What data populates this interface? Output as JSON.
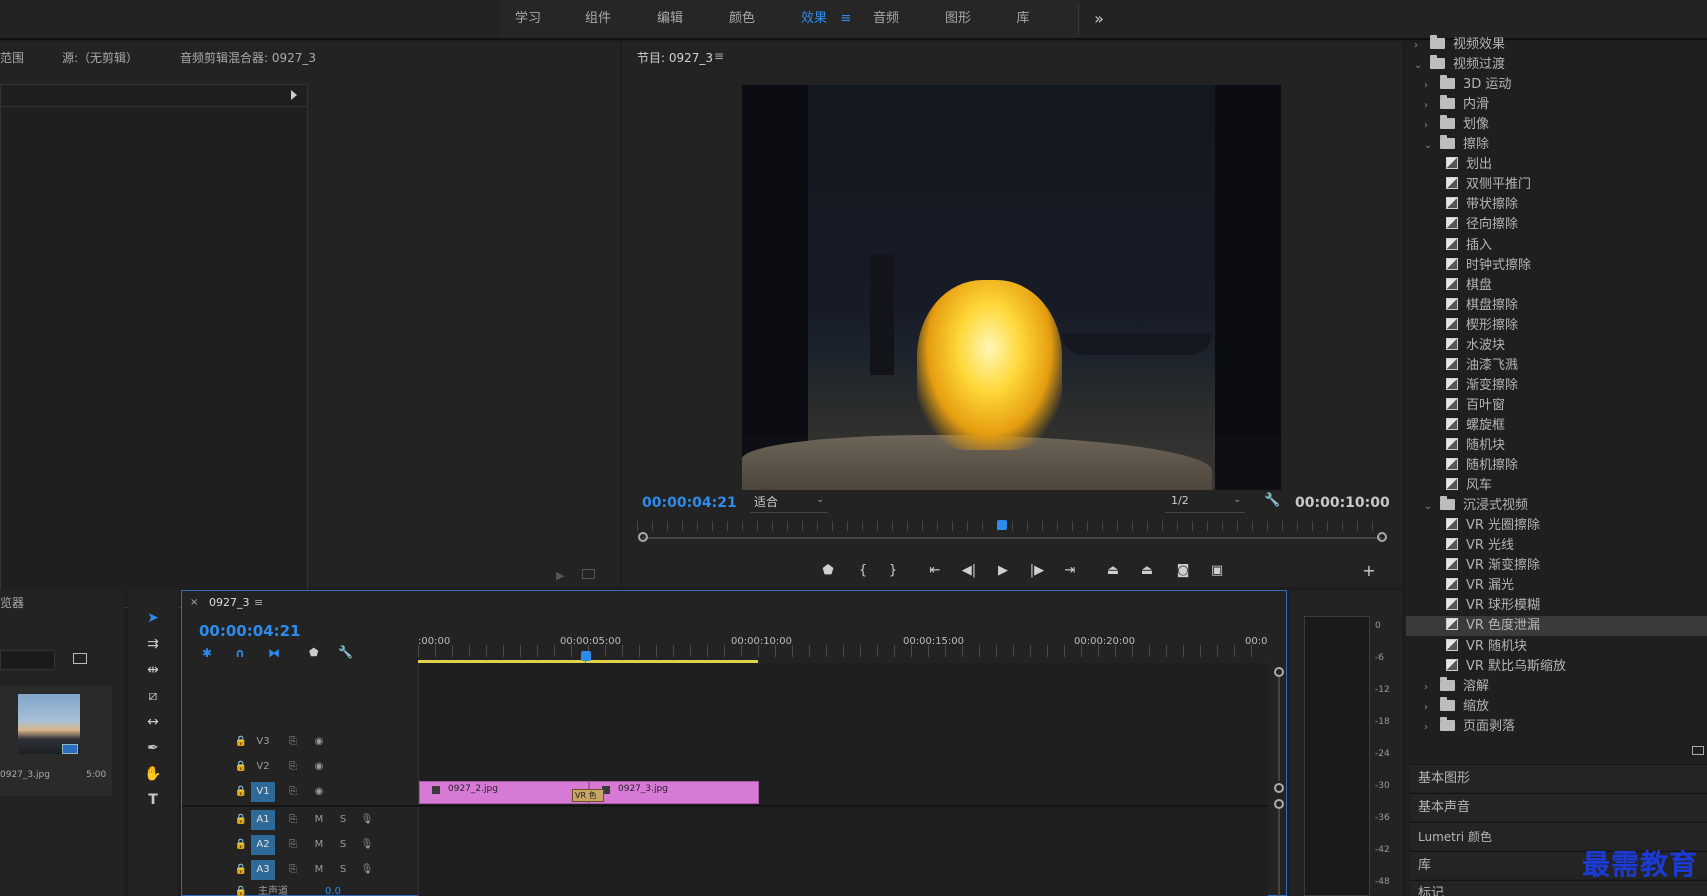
{
  "workspaces": [
    "学习",
    "组件",
    "编辑",
    "颜色",
    "效果",
    "音频",
    "图形",
    "库"
  ],
  "active_workspace": "效果",
  "menu_glyph": "≡",
  "more_glyph": "»",
  "source_panel": {
    "tab_range": "范围",
    "tab_source": "源:（无剪辑）",
    "tab_mixer": "音频剪辑混合器: 0927_3"
  },
  "program": {
    "title": "节目: 0927_3",
    "current_time": "00:00:04:21",
    "fit_value": "适合",
    "resolution_value": "1/2",
    "duration": "00:00:10:00",
    "playhead_fraction": 0.48
  },
  "project": {
    "tab_label": "览器",
    "clip_name": "0927_3.jpg",
    "clip_duration": "5:00"
  },
  "timeline": {
    "sequence_tab": "0927_3",
    "current_time": "00:00:04:21",
    "ruler_labels": [
      ":00:00",
      "00:00:05:00",
      "00:00:10:00",
      "00:00:15:00",
      "00:00:20:00",
      "00:0"
    ],
    "tracks": [
      {
        "name": "V3",
        "kind": "video",
        "on": false
      },
      {
        "name": "V2",
        "kind": "video",
        "on": false
      },
      {
        "name": "V1",
        "kind": "video",
        "on": true
      },
      {
        "name": "A1",
        "kind": "audio",
        "on": true
      },
      {
        "name": "A2",
        "kind": "audio",
        "on": true
      },
      {
        "name": "A3",
        "kind": "audio",
        "on": true
      }
    ],
    "master_label": "主声道",
    "master_value": "0.0",
    "mute_label": "M",
    "solo_label": "S",
    "clips": [
      {
        "name": "0927_2.jpg"
      },
      {
        "name": "0927_3.jpg"
      }
    ],
    "transition_label": "VR 色"
  },
  "meter": {
    "labels": [
      "0",
      "-6",
      "-12",
      "-18",
      "-24",
      "-30",
      "-36",
      "-42",
      "-48"
    ]
  },
  "effects_tree": [
    {
      "label": "视频效果",
      "type": "folder",
      "level": 0,
      "expanded": false
    },
    {
      "label": "视频过渡",
      "type": "folder",
      "level": 0,
      "expanded": true
    },
    {
      "label": "3D 运动",
      "type": "folder",
      "level": 1,
      "expanded": false
    },
    {
      "label": "内滑",
      "type": "folder",
      "level": 1,
      "expanded": false
    },
    {
      "label": "划像",
      "type": "folder",
      "level": 1,
      "expanded": false
    },
    {
      "label": "擦除",
      "type": "folder",
      "level": 1,
      "expanded": true
    },
    {
      "label": "划出",
      "type": "effect",
      "level": 2
    },
    {
      "label": "双侧平推门",
      "type": "effect",
      "level": 2
    },
    {
      "label": "带状擦除",
      "type": "effect",
      "level": 2
    },
    {
      "label": "径向擦除",
      "type": "effect",
      "level": 2
    },
    {
      "label": "插入",
      "type": "effect",
      "level": 2
    },
    {
      "label": "时钟式擦除",
      "type": "effect",
      "level": 2
    },
    {
      "label": "棋盘",
      "type": "effect",
      "level": 2
    },
    {
      "label": "棋盘擦除",
      "type": "effect",
      "level": 2
    },
    {
      "label": "楔形擦除",
      "type": "effect",
      "level": 2
    },
    {
      "label": "水波块",
      "type": "effect",
      "level": 2
    },
    {
      "label": "油漆飞溅",
      "type": "effect",
      "level": 2
    },
    {
      "label": "渐变擦除",
      "type": "effect",
      "level": 2
    },
    {
      "label": "百叶窗",
      "type": "effect",
      "level": 2
    },
    {
      "label": "螺旋框",
      "type": "effect",
      "level": 2
    },
    {
      "label": "随机块",
      "type": "effect",
      "level": 2
    },
    {
      "label": "随机擦除",
      "type": "effect",
      "level": 2
    },
    {
      "label": "风车",
      "type": "effect",
      "level": 2
    },
    {
      "label": "沉浸式视频",
      "type": "folder",
      "level": 1,
      "expanded": true
    },
    {
      "label": "VR 光圈擦除",
      "type": "effect",
      "level": 2
    },
    {
      "label": "VR 光线",
      "type": "effect",
      "level": 2
    },
    {
      "label": "VR 渐变擦除",
      "type": "effect",
      "level": 2
    },
    {
      "label": "VR 漏光",
      "type": "effect",
      "level": 2
    },
    {
      "label": "VR 球形模糊",
      "type": "effect",
      "level": 2
    },
    {
      "label": "VR 色度泄漏",
      "type": "effect",
      "level": 2,
      "selected": true
    },
    {
      "label": "VR 随机块",
      "type": "effect",
      "level": 2
    },
    {
      "label": "VR 默比乌斯缩放",
      "type": "effect",
      "level": 2
    },
    {
      "label": "溶解",
      "type": "folder",
      "level": 1,
      "expanded": false
    },
    {
      "label": "缩放",
      "type": "folder",
      "level": 1,
      "expanded": false
    },
    {
      "label": "页面剥落",
      "type": "folder",
      "level": 1,
      "expanded": false
    }
  ],
  "side_sections": [
    "基本图形",
    "基本声音",
    "Lumetri 颜色",
    "库",
    "标记"
  ],
  "watermark": "最需教育"
}
